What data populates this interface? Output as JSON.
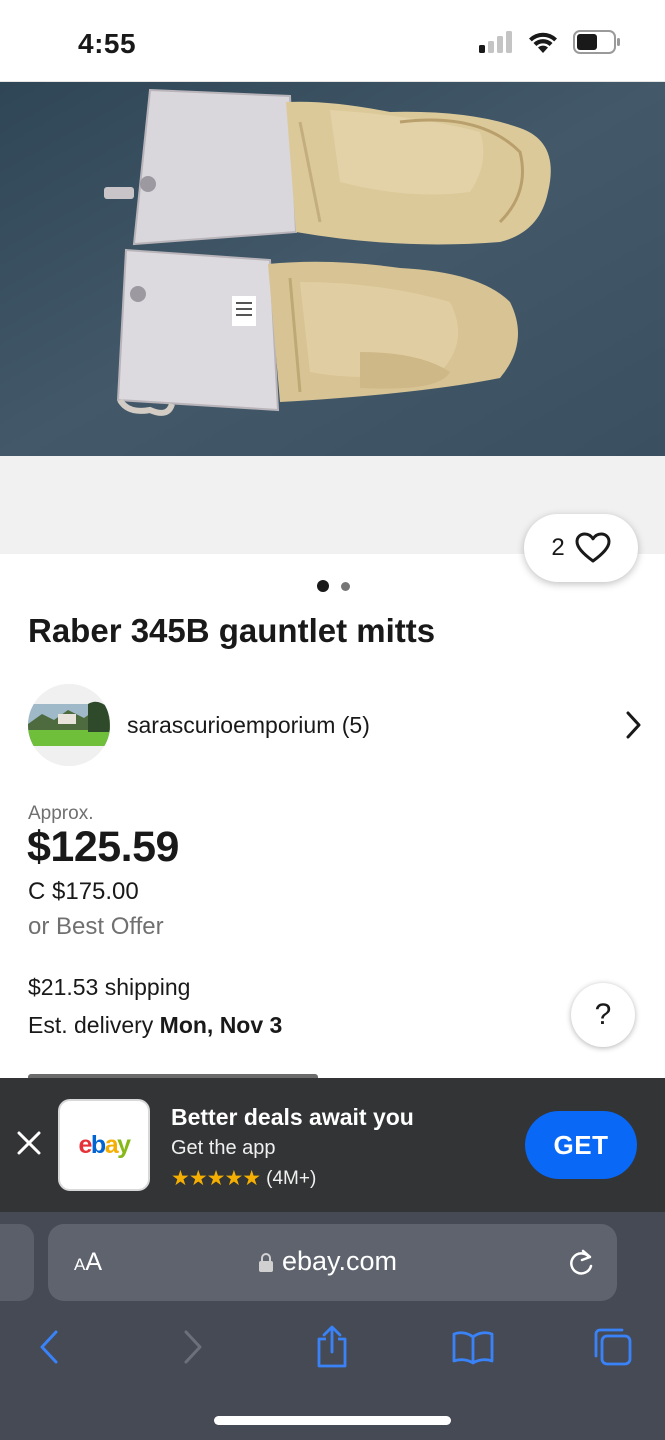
{
  "status_bar": {
    "time": "4:55",
    "icons": [
      "cellular-signal-icon",
      "wifi-icon",
      "battery-icon"
    ]
  },
  "product": {
    "image_alt_icon": "gauntlet-mitts-photo",
    "watch_count": "2",
    "image_page": {
      "current": 1,
      "total": 2
    },
    "title": "Raber 345B gauntlet mitts"
  },
  "seller": {
    "name": "sarascurioemporium (5)"
  },
  "pricing": {
    "approx_label": "Approx.",
    "price": "$125.59",
    "original_price": "C $175.00",
    "best_offer": "or Best Offer"
  },
  "shipping": {
    "cost": "$21.53 shipping",
    "delivery_label": "Est. delivery ",
    "delivery_date": "Mon, Nov 3"
  },
  "help_button": {
    "label": "?"
  },
  "app_banner": {
    "logo_letters": [
      "e",
      "b",
      "a",
      "y"
    ],
    "logo_colors": [
      "#e53238",
      "#0064d2",
      "#f5af02",
      "#86b817"
    ],
    "title": "Better deals await you",
    "subtitle": "Get the app",
    "stars": "★★★★★",
    "rating_count": "(4M+)",
    "get_label": "GET",
    "get_color": "#0968f6"
  },
  "browser": {
    "text_size_label_small": "A",
    "text_size_label_large": "A",
    "url": "ebay.com",
    "toolbar_icons": [
      "back-icon",
      "forward-icon",
      "share-icon",
      "bookmarks-icon",
      "tabs-icon"
    ],
    "accent_color": "#3a82f7"
  }
}
